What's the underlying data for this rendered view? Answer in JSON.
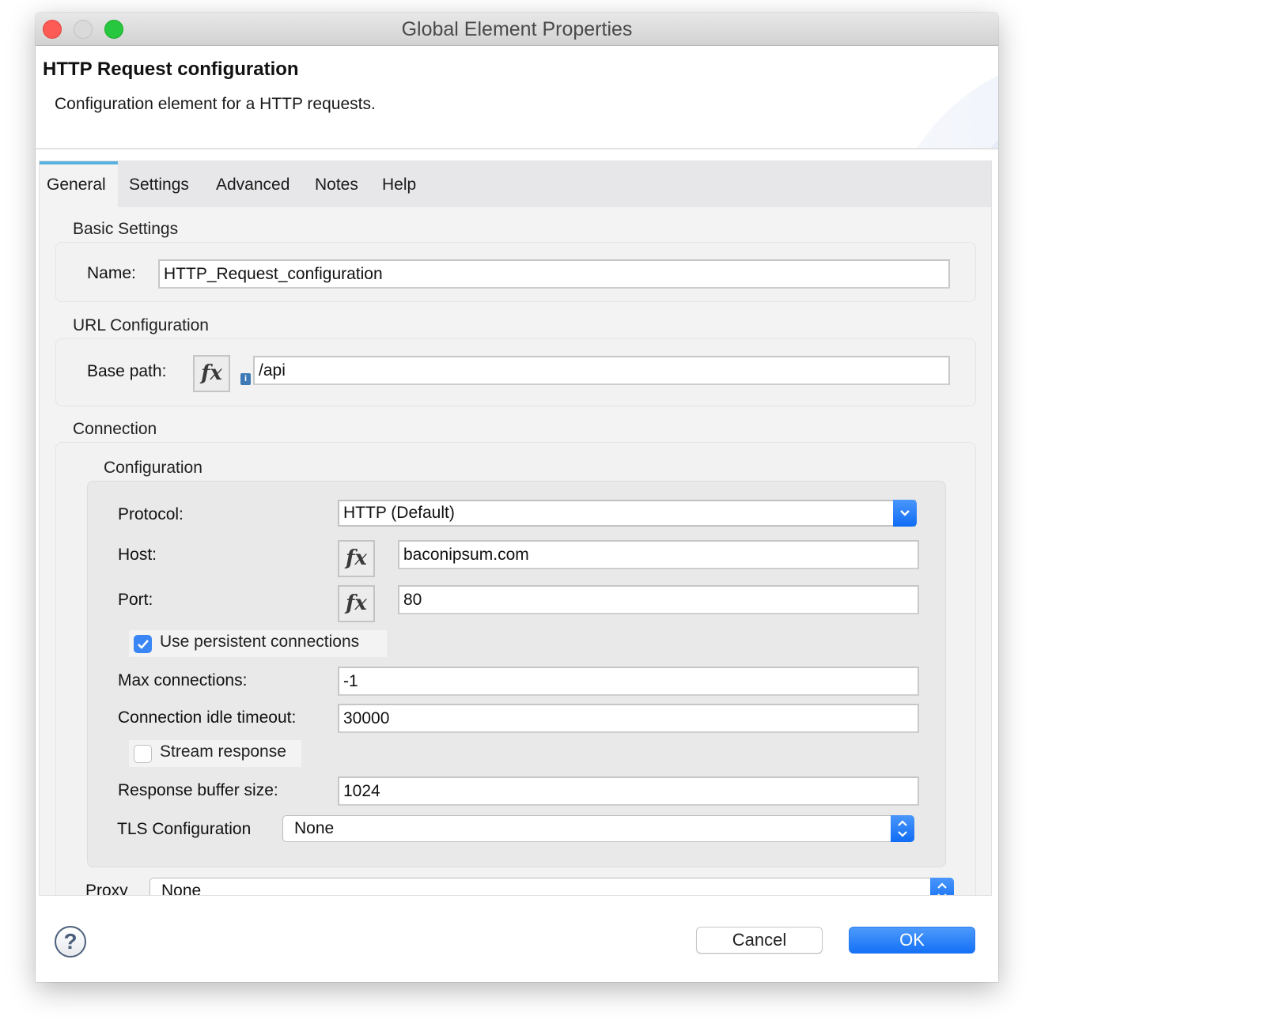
{
  "window": {
    "title": "Global Element Properties"
  },
  "header": {
    "title": "HTTP Request configuration",
    "description": "Configuration element for a HTTP requests."
  },
  "tabs": [
    {
      "label": "General",
      "active": true
    },
    {
      "label": "Settings",
      "active": false
    },
    {
      "label": "Advanced",
      "active": false
    },
    {
      "label": "Notes",
      "active": false
    },
    {
      "label": "Help",
      "active": false
    }
  ],
  "basic_settings": {
    "section_label": "Basic Settings",
    "name_label": "Name:",
    "name_value": "HTTP_Request_configuration"
  },
  "url_configuration": {
    "section_label": "URL Configuration",
    "base_path_label": "Base path:",
    "base_path_value": "/api",
    "fx_label": "fx",
    "info_glyph": "i"
  },
  "connection": {
    "section_label": "Connection",
    "configuration_label": "Configuration",
    "protocol_label": "Protocol:",
    "protocol_value": "HTTP (Default)",
    "host_label": "Host:",
    "host_value": "baconipsum.com",
    "port_label": "Port:",
    "port_value": "80",
    "persistent_label": "Use persistent connections",
    "persistent_checked": true,
    "max_connections_label": "Max connections:",
    "max_connections_value": "-1",
    "idle_timeout_label": "Connection idle timeout:",
    "idle_timeout_value": "30000",
    "stream_response_label": "Stream response",
    "stream_response_checked": false,
    "buffer_size_label": "Response buffer size:",
    "buffer_size_value": "1024",
    "tls_label": "TLS Configuration",
    "tls_value": "None",
    "proxy_label": "Proxy",
    "proxy_value": "None"
  },
  "footer": {
    "help_glyph": "?",
    "cancel_label": "Cancel",
    "ok_label": "OK"
  },
  "colors": {
    "accent": "#1471f6",
    "tab_indicator": "#5ab1e0",
    "close": "#fd5b56",
    "maximize": "#27c840"
  }
}
